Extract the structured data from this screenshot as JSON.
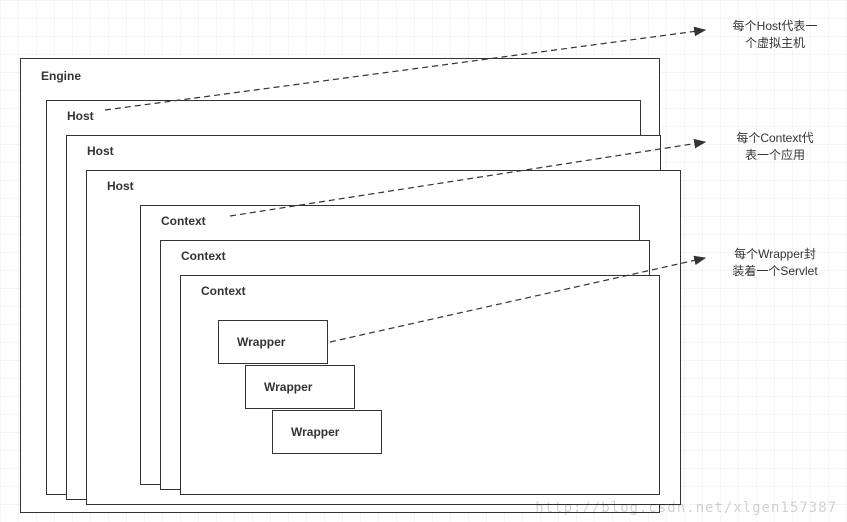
{
  "diagram": {
    "engine_label": "Engine",
    "host_label": "Host",
    "context_label": "Context",
    "wrapper_label": "Wrapper"
  },
  "annotations": {
    "host_line1": "每个Host代表一",
    "host_line2": "个虚拟主机",
    "context_line1": "每个Context代",
    "context_line2": "表一个应用",
    "wrapper_line1": "每个Wrapper封",
    "wrapper_line2": "装着一个Servlet"
  },
  "watermark": "http://blog.csdn.net/xlgen157387"
}
